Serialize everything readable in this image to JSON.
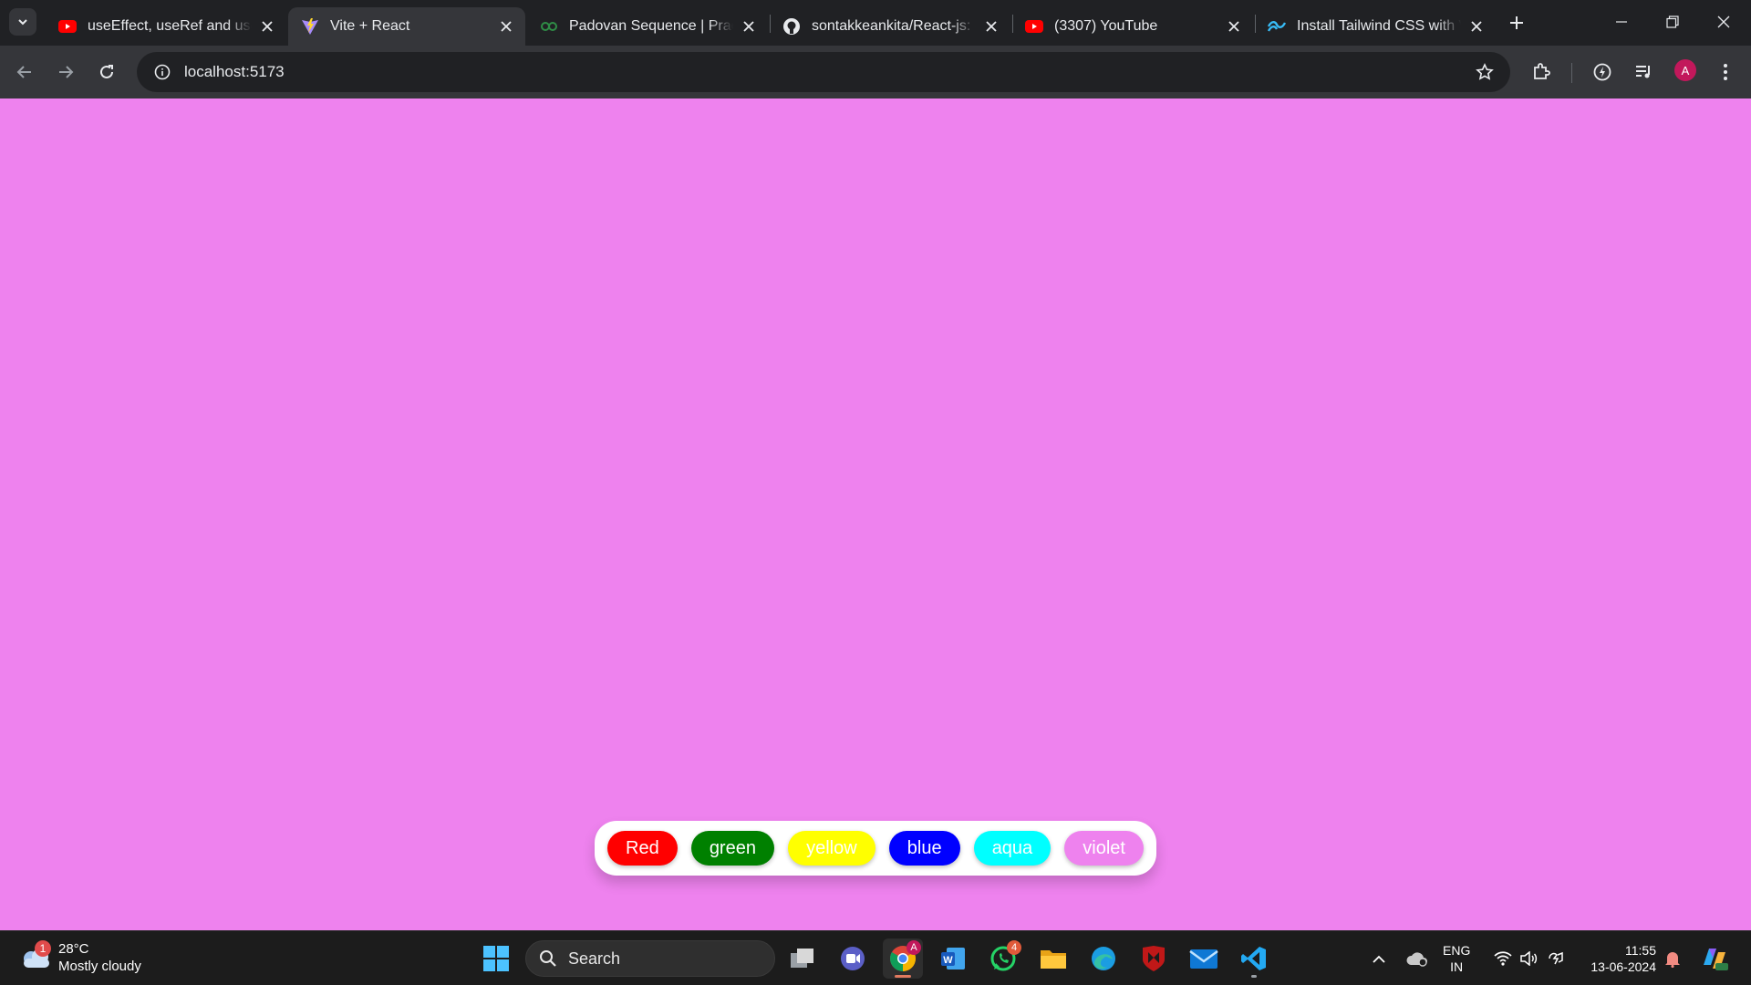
{
  "browser": {
    "tabs": [
      {
        "title": "useEffect, useRef and useCallback",
        "icon": "youtube-icon",
        "active": false
      },
      {
        "title": "Vite + React",
        "icon": "vite-icon",
        "active": true
      },
      {
        "title": "Padovan Sequence | Practice",
        "icon": "geeksforgeeks-icon",
        "active": false
      },
      {
        "title": "sontakkeankita/React-js: code",
        "icon": "github-icon",
        "active": false
      },
      {
        "title": "(3307) YouTube",
        "icon": "youtube-icon",
        "active": false
      },
      {
        "title": "Install Tailwind CSS with Vite",
        "icon": "tailwind-icon",
        "active": false
      }
    ],
    "url": "localhost:5173",
    "profile_initial": "A"
  },
  "app": {
    "background_color": "#ee82ee",
    "buttons": [
      {
        "label": "Red",
        "color": "#ff0000"
      },
      {
        "label": "green",
        "color": "#008000"
      },
      {
        "label": "yellow",
        "color": "#ffff00"
      },
      {
        "label": "blue",
        "color": "#0000ff"
      },
      {
        "label": "aqua",
        "color": "#00ffff"
      },
      {
        "label": "violet",
        "color": "#ee82ee"
      }
    ]
  },
  "taskbar": {
    "weather": {
      "temp": "28°C",
      "condition": "Mostly cloudy",
      "badge": "1"
    },
    "search_placeholder": "Search",
    "chrome_badge": "A",
    "whatsapp_badge": "4",
    "language": {
      "line1": "ENG",
      "line2": "IN"
    },
    "time": "11:55",
    "date": "13-06-2024"
  }
}
